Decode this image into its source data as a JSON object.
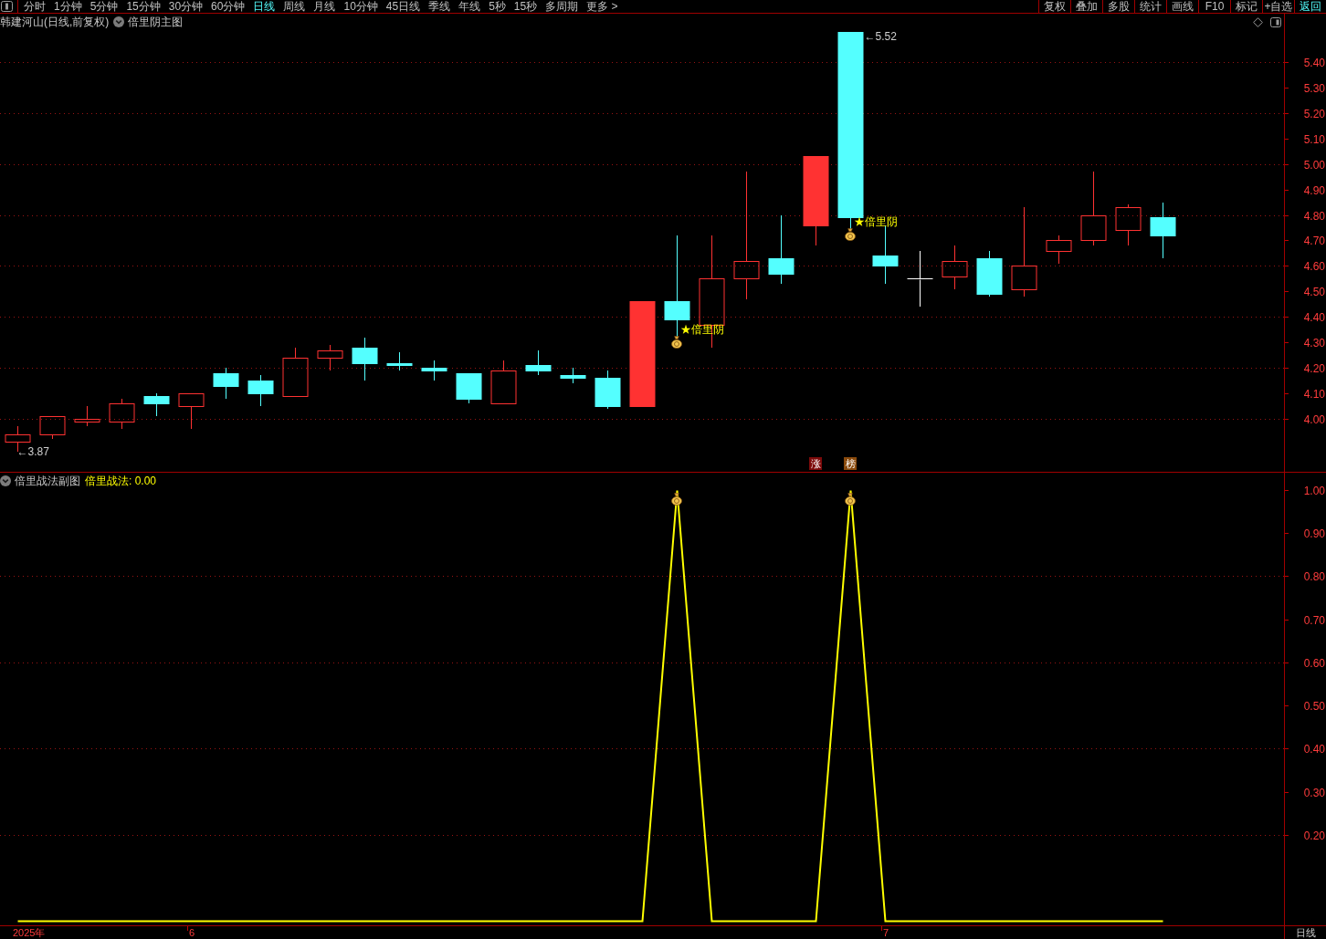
{
  "toolbar": {
    "periods": [
      {
        "label": "分时",
        "selected": false
      },
      {
        "label": "1分钟",
        "selected": false
      },
      {
        "label": "5分钟",
        "selected": false
      },
      {
        "label": "15分钟",
        "selected": false
      },
      {
        "label": "30分钟",
        "selected": false
      },
      {
        "label": "60分钟",
        "selected": false
      },
      {
        "label": "日线",
        "selected": true
      },
      {
        "label": "周线",
        "selected": false
      },
      {
        "label": "月线",
        "selected": false
      },
      {
        "label": "10分钟",
        "selected": false
      },
      {
        "label": "45日线",
        "selected": false
      },
      {
        "label": "季线",
        "selected": false
      },
      {
        "label": "年线",
        "selected": false
      },
      {
        "label": "5秒",
        "selected": false
      },
      {
        "label": "15秒",
        "selected": false
      },
      {
        "label": "多周期",
        "selected": false
      },
      {
        "label": "更多 >",
        "selected": false
      }
    ],
    "actions": [
      {
        "label": "复权",
        "highlighted": false
      },
      {
        "label": "叠加",
        "highlighted": false
      },
      {
        "label": "多股",
        "highlighted": false
      },
      {
        "label": "统计",
        "highlighted": false
      },
      {
        "label": "画线",
        "highlighted": false
      },
      {
        "label": "F10",
        "highlighted": false
      },
      {
        "label": "标记",
        "highlighted": false
      },
      {
        "label": "+自选",
        "highlighted": false
      },
      {
        "label": "返回",
        "highlighted": true
      }
    ]
  },
  "main_panel": {
    "stock": "韩建河山(日线,前复权)",
    "indicator": "倍里阴主图",
    "chart_data": {
      "type": "candlestick",
      "categories": [
        null,
        null,
        null,
        null,
        null,
        null,
        null,
        null,
        null,
        null,
        null,
        null,
        null,
        null,
        null,
        null,
        null,
        null,
        null,
        null,
        null,
        null,
        null,
        null,
        null,
        null,
        null,
        null,
        null,
        null,
        null,
        null,
        null,
        null,
        null,
        null,
        null
      ],
      "ylim": [
        3.792,
        5.59
      ],
      "grid": true,
      "yticks": [
        {
          "value": 4.0,
          "label": "4.00"
        },
        {
          "value": 4.1,
          "label": "4.10"
        },
        {
          "value": 4.2,
          "label": "4.20"
        },
        {
          "value": 4.3,
          "label": "4.30"
        },
        {
          "value": 4.4,
          "label": "4.40"
        },
        {
          "value": 4.5,
          "label": "4.50"
        },
        {
          "value": 4.6,
          "label": "4.60"
        },
        {
          "value": 4.7,
          "label": "4.70"
        },
        {
          "value": 4.8,
          "label": "4.80"
        },
        {
          "value": 4.9,
          "label": "4.90"
        },
        {
          "value": 5.0,
          "label": "5.00"
        },
        {
          "value": 5.1,
          "label": "5.10"
        },
        {
          "value": 5.2,
          "label": "5.20"
        },
        {
          "value": 5.3,
          "label": "5.30"
        },
        {
          "value": 5.4,
          "label": "5.40"
        }
      ],
      "annotations": [
        "←3.87",
        "★倍里阴",
        "←5.52",
        "★倍里阴"
      ]
    },
    "tags": [
      {
        "text": "涨",
        "color": "#7c0a0a"
      },
      {
        "text": "榜",
        "color": "#8a4a0c"
      }
    ]
  },
  "sub_panel": {
    "indicator": "倍里战法副图",
    "reading": "倍里战法: 0.00",
    "chart_data": {
      "type": "line",
      "categories": [
        null,
        null,
        null,
        null,
        null,
        "6",
        null,
        null,
        null,
        null,
        null,
        null,
        null,
        null,
        null,
        null,
        null,
        null,
        null,
        null,
        null,
        null,
        null,
        null,
        null,
        "7",
        null,
        null,
        null,
        null,
        null,
        null,
        null,
        null,
        null,
        null,
        null
      ],
      "ylim": [
        -0.01,
        1.04
      ],
      "grid": true,
      "yticks": [
        {
          "value": 0.2,
          "label": "0.20"
        },
        {
          "value": 0.3,
          "label": "0.30"
        },
        {
          "value": 0.4,
          "label": "0.40"
        },
        {
          "value": 0.5,
          "label": "0.50"
        },
        {
          "value": 0.6,
          "label": "0.60"
        },
        {
          "value": 0.7,
          "label": "0.70"
        },
        {
          "value": 0.8,
          "label": "0.80"
        },
        {
          "value": 0.9,
          "label": "0.90"
        },
        {
          "value": 1.0,
          "label": "1.00"
        }
      ],
      "series": [
        {
          "color": "#ffff00",
          "values": [
            0,
            0,
            0,
            0,
            0,
            0,
            0,
            0,
            0,
            0,
            0,
            0,
            0,
            0,
            0,
            0,
            0,
            0,
            0,
            1,
            0,
            0,
            0,
            0,
            1,
            0,
            0,
            0,
            0,
            0,
            0,
            0,
            0,
            0,
            null,
            null,
            null
          ]
        }
      ]
    },
    "year_label": "2025年"
  },
  "period_label": "日线"
}
